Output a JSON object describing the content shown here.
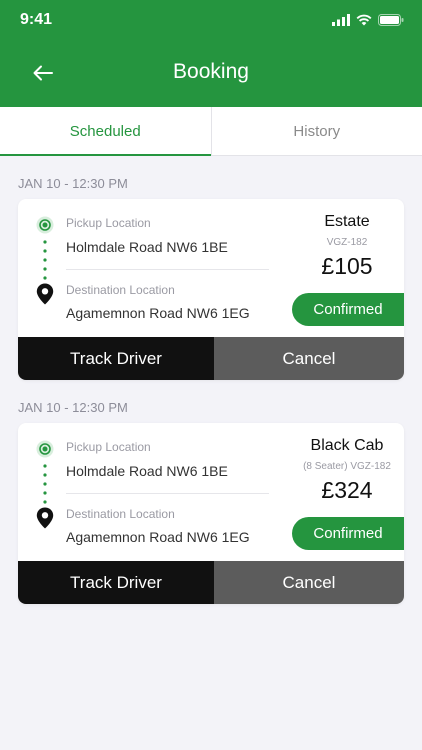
{
  "status_bar": {
    "time": "9:41"
  },
  "header": {
    "title": "Booking"
  },
  "tabs": [
    {
      "label": "Scheduled",
      "active": true
    },
    {
      "label": "History",
      "active": false
    }
  ],
  "bookings": [
    {
      "date": "JAN 10 - 12:30 PM",
      "pickup_label": "Pickup Location",
      "pickup": "Holmdale Road NW6 1BE",
      "destination_label": "Destination Location",
      "destination": "Agamemnon Road NW6 1EG",
      "vehicle": "Estate",
      "vehicle_detail": "VGZ-182",
      "price": "£105",
      "status": "Confirmed",
      "track_label": "Track Driver",
      "cancel_label": "Cancel"
    },
    {
      "date": "JAN 10 - 12:30 PM",
      "pickup_label": "Pickup Location",
      "pickup": "Holmdale Road NW6 1BE",
      "destination_label": "Destination Location",
      "destination": "Agamemnon Road NW6 1EG",
      "vehicle": "Black Cab",
      "vehicle_detail": "(8 Seater) VGZ-182",
      "price": "£324",
      "status": "Confirmed",
      "track_label": "Track Driver",
      "cancel_label": "Cancel"
    }
  ],
  "colors": {
    "brand": "#25953f",
    "dark_button": "#111111",
    "grey_button": "#5c5c5c"
  },
  "icons": [
    "back-arrow-icon",
    "signal-icon",
    "wifi-icon",
    "battery-icon",
    "pickup-marker-icon",
    "destination-pin-icon"
  ]
}
